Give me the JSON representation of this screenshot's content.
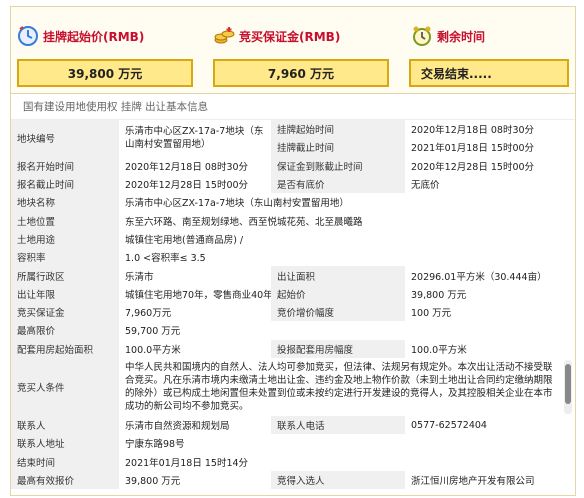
{
  "stats": {
    "start_price_label": "挂牌起始价(RMB)",
    "start_price_value": "39,800 万元",
    "deposit_label": "竞买保证金(RMB)",
    "deposit_value": "7,960 万元",
    "remaining_label": "剩余时间",
    "remaining_value": "交易结束....."
  },
  "section_title": "国有建设用地使用权 挂牌 出让基本信息",
  "rows": [
    [
      "地块编号",
      "乐清市中心区ZX-17a-7地块（东山南村安置留用地）",
      "挂牌起始时间",
      "2020年12月18日 08时30分"
    ],
    [
      "",
      "",
      "挂牌截止时间",
      "2021年01月18日 15时00分"
    ],
    [
      "报名开始时间",
      "2020年12月18日 08时30分",
      "保证金到账截止时间",
      "2020年12月28日 15时00分"
    ],
    [
      "报名截止时间",
      "2020年12月28日 15时00分",
      "是否有底价",
      "无底价"
    ],
    [
      "地块名称",
      "乐清市中心区ZX-17a-7地块（东山南村安置留用地）",
      "",
      ""
    ],
    [
      "土地位置",
      "东至六环路、南至规划绿地、西至悦城花苑、北至晨曦路",
      "",
      ""
    ],
    [
      "土地用途",
      "城镇住宅用地(普通商品房) /",
      "",
      ""
    ],
    [
      "容积率",
      "1.0 <容积率≤ 3.5",
      "",
      ""
    ],
    [
      "所属行政区",
      "乐清市",
      "出让面积",
      "20296.01平方米（30.444亩）"
    ],
    [
      "出让年限",
      "城镇住宅用地70年，零售商业40年",
      "起始价",
      "39,800 万元"
    ],
    [
      "竞买保证金",
      "7,960万元",
      "竞价增价幅度",
      "100 万元"
    ],
    [
      "最高限价",
      "59,700 万元",
      "",
      ""
    ],
    [
      "配套用房起始面积",
      "100.0平方米",
      "投报配套用房幅度",
      "100.0平方米"
    ],
    [
      "竞买人条件",
      "中华人民共和国境内的自然人、法人均可参加竞买，但法律、法规另有规定外。本次出让活动不接受联合竞买。凡在乐清市境内未缴清土地出让金、违约金及地上物作价款（未到土地出让合同约定缴纳期限的除外）或已构成土地闲置但未处置到位或未按约定进行开发建设的竞得人，及其控股相关企业在本市成功的新公司均不参加竞买。",
      "",
      ""
    ],
    [
      "联系人",
      "乐清市自然资源和规划局",
      "联系人电话",
      "0577-62572404"
    ],
    [
      "联系人地址",
      "宁康东路98号",
      "",
      ""
    ],
    [
      "结束时间",
      "2021年01月18日 15时14分",
      "",
      ""
    ],
    [
      "最高有效报价",
      "39,800 万元",
      "竞得入选人",
      "浙江恒川房地产开发有限公司"
    ]
  ],
  "colors": {
    "accent_red": "#c8102e",
    "box_fill": "#ffe98a",
    "box_border": "#d8a810"
  },
  "icons": [
    "clock-icon",
    "coins-icon",
    "alarm-clock-icon"
  ]
}
